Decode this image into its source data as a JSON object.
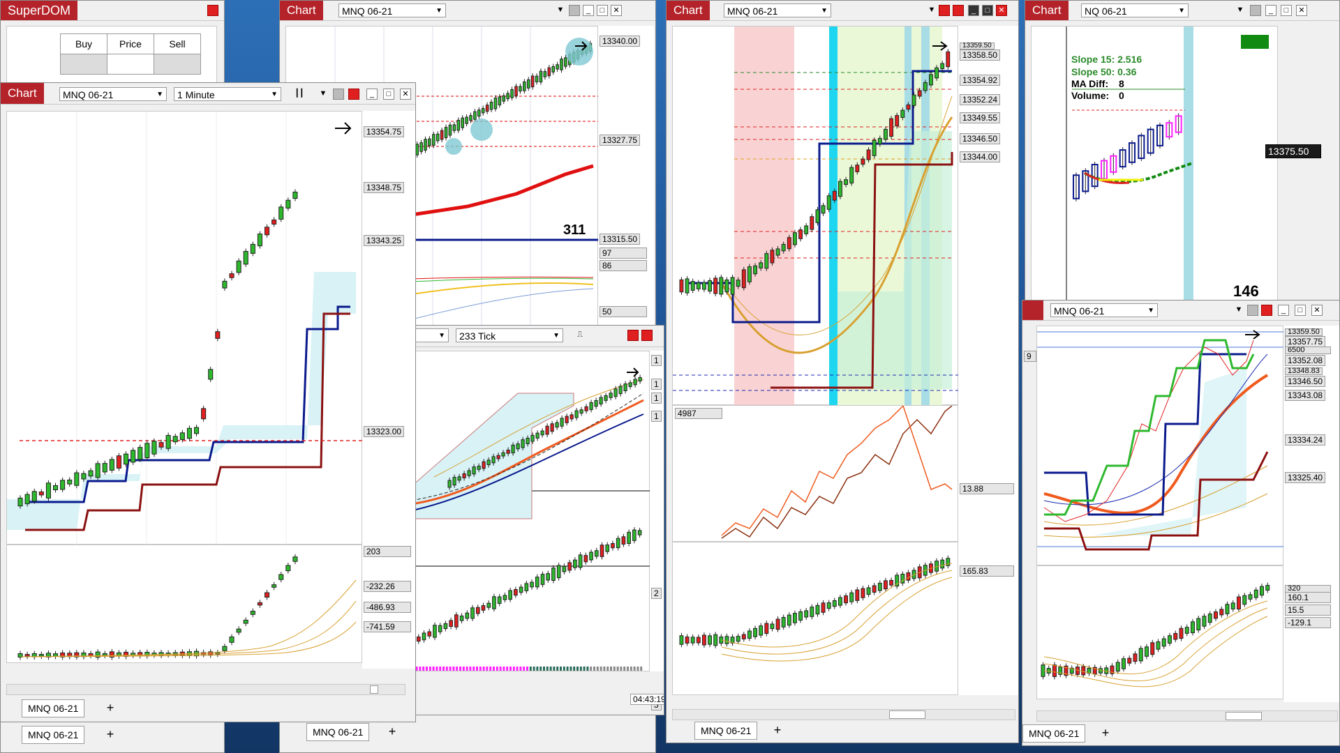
{
  "superdom": {
    "title": "SuperDOM",
    "cols": [
      "Buy",
      "Price",
      "Sell"
    ],
    "tab": "MNQ 06-21"
  },
  "win1": {
    "title": "Chart",
    "instrument": "MNQ 06-21",
    "prices": [
      "13340.00",
      "13327.75",
      "13315.50",
      "97",
      "86",
      "50"
    ],
    "big_count": "311",
    "tab": "MNQ 06-21"
  },
  "win2": {
    "title": "Chart",
    "instrument": "MNQ 06-21",
    "prices": [
      "13358.50",
      "13354.92",
      "13352.24",
      "13349.55",
      "13346.50",
      "13344.00",
      "13359.50",
      "4987",
      "13.88",
      "165.83"
    ],
    "tab": "MNQ 06-21"
  },
  "win3": {
    "title": "Chart",
    "instrument": "NQ 06-21",
    "slope15": "Slope 15: 2.516",
    "slope50": "Slope 50: 0.36",
    "ma_diff_label": "MA Diff:",
    "ma_diff": "8",
    "volume_label": "Volume:",
    "volume": "0",
    "price": "13375.50",
    "big_count": "146"
  },
  "win4": {
    "title": "Chart",
    "instrument": "MNQ 06-21",
    "interval": "1 Minute",
    "prices": [
      "13354.75",
      "13348.75",
      "13343.25",
      "13323.00",
      "203",
      "-232.26",
      "-486.93",
      "-741.59"
    ],
    "tab": "MNQ 06-21"
  },
  "win5": {
    "instrument_interval": "233 Tick",
    "time": "04:43:19",
    "prices": [
      "1",
      "1",
      "1",
      "1",
      "2",
      "3"
    ]
  },
  "win6": {
    "instrument": "MNQ 06-21",
    "prices": [
      "13359.50",
      "13357.75",
      "6500",
      "13352.08",
      "13348.83",
      "13346.50",
      "13343.08",
      "13334.24",
      "13325.40",
      "320",
      "160.1",
      "15.5",
      "-129.1",
      "9"
    ],
    "tab": "MNQ 06-21"
  },
  "colors": {
    "title_red": "#b5232a",
    "candle_up": "#2db82d",
    "candle_down": "#e02020",
    "navy": "#0a1a8c",
    "maroon": "#8b1010",
    "cyan_band": "#1fd6f0",
    "orange": "#f05a1e"
  }
}
